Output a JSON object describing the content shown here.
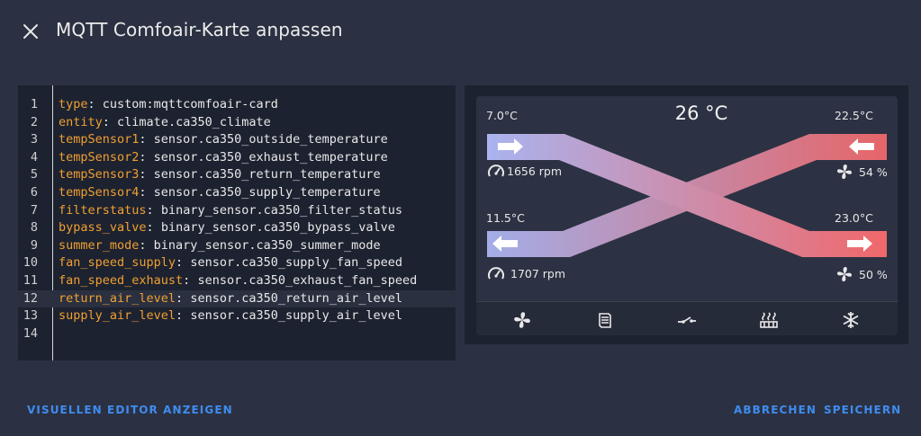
{
  "dialog": {
    "title": "MQTT Comfoair-Karte anpassen",
    "close_icon": "close-icon"
  },
  "editor": {
    "lines": [
      {
        "n": "1",
        "key": "type",
        "val": "custom:mqttcomfoair-card"
      },
      {
        "n": "2",
        "key": "entity",
        "val": "climate.ca350_climate"
      },
      {
        "n": "3",
        "key": "tempSensor1",
        "val": "sensor.ca350_outside_temperature"
      },
      {
        "n": "4",
        "key": "tempSensor2",
        "val": "sensor.ca350_exhaust_temperature"
      },
      {
        "n": "5",
        "key": "tempSensor3",
        "val": "sensor.ca350_return_temperature"
      },
      {
        "n": "6",
        "key": "tempSensor4",
        "val": "sensor.ca350_supply_temperature"
      },
      {
        "n": "7",
        "key": "filterstatus",
        "val": "binary_sensor.ca350_filter_status"
      },
      {
        "n": "8",
        "key": "bypass_valve",
        "val": "binary_sensor.ca350_bypass_valve"
      },
      {
        "n": "9",
        "key": "summer_mode",
        "val": "binary_sensor.ca350_summer_mode"
      },
      {
        "n": "10",
        "key": "fan_speed_supply",
        "val": "sensor.ca350_supply_fan_speed"
      },
      {
        "n": "11",
        "key": "fan_speed_exhaust",
        "val": "sensor.ca350_exhaust_fan_speed"
      },
      {
        "n": "12",
        "key": "return_air_level",
        "val": "sensor.ca350_return_air_level"
      },
      {
        "n": "13",
        "key": "supply_air_level",
        "val": "sensor.ca350_supply_air_level"
      },
      {
        "n": "14",
        "key": "",
        "val": ""
      }
    ],
    "active_line": 12
  },
  "card": {
    "center_temp": "26 °C",
    "temp_outside": "7.0°C",
    "temp_exhaust": "11.5°C",
    "temp_return": "22.5°C",
    "temp_supply": "23.0°C",
    "rpm_top": "1656 rpm",
    "rpm_bottom": "1707 rpm",
    "level_top": "54 %",
    "level_bottom": "50 %",
    "colors": {
      "cold": "#a9b4f0",
      "warm": "#f0686a"
    },
    "footer_icons": [
      "fan-icon",
      "filter-icon",
      "bypass-valve-icon",
      "heater-icon",
      "snowflake-icon"
    ]
  },
  "actions": {
    "visual_editor": "VISUELLEN EDITOR ANZEIGEN",
    "cancel": "ABBRECHEN",
    "save": "SPEICHERN"
  }
}
